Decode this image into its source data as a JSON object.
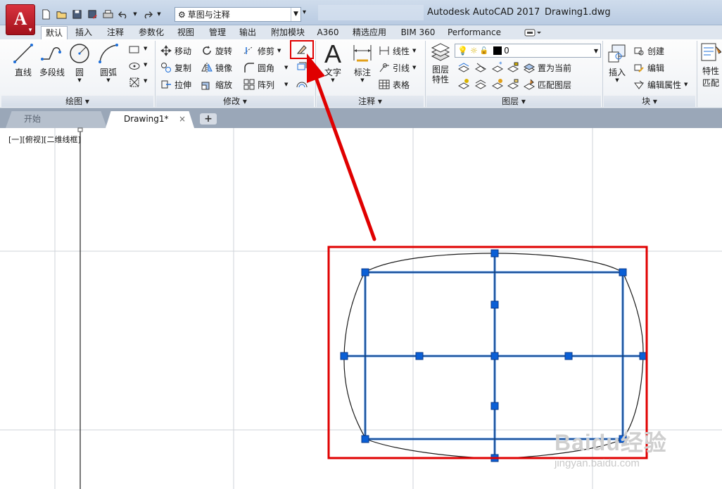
{
  "titlebar": {
    "app_logo": "A",
    "workspace": "草图与注释",
    "app_name": "Autodesk AutoCAD 2017",
    "document": "Drawing1.dwg",
    "qat_icons": [
      "new-icon",
      "open-icon",
      "save-icon",
      "save-as-icon",
      "plot-icon",
      "undo-icon",
      "redo-icon",
      "gear-icon"
    ]
  },
  "ribbon_tabs": [
    {
      "label": "默认",
      "active": true
    },
    {
      "label": "插入"
    },
    {
      "label": "注释"
    },
    {
      "label": "参数化"
    },
    {
      "label": "视图"
    },
    {
      "label": "管理"
    },
    {
      "label": "输出"
    },
    {
      "label": "附加模块"
    },
    {
      "label": "A360"
    },
    {
      "label": "精选应用"
    },
    {
      "label": "BIM 360"
    },
    {
      "label": "Performance"
    }
  ],
  "draw_panel": {
    "title": "绘图",
    "line": "直线",
    "polyline": "多段线",
    "circle": "圆",
    "arc": "圆弧"
  },
  "modify_panel": {
    "title": "修改",
    "move": "移动",
    "rotate": "旋转",
    "trim": "修剪",
    "copy": "复制",
    "mirror": "镜像",
    "fillet": "圆角",
    "stretch": "拉伸",
    "scale": "缩放",
    "array": "阵列",
    "highlighted_tool": "eraser-icon"
  },
  "annotation_panel": {
    "title": "注释",
    "text": "文字",
    "dimension": "标注",
    "linear": "线性",
    "leader": "引线",
    "table": "表格"
  },
  "layers_panel": {
    "title": "图层",
    "layer_properties": "图层\n特性",
    "current_layer": "0",
    "make_current": "置为当前",
    "match_layer": "匹配图层"
  },
  "block_panel": {
    "title": "块",
    "insert": "插入",
    "create": "创建",
    "edit": "编辑",
    "edit_attributes": "编辑属性"
  },
  "properties_panel": {
    "properties": "特性",
    "match": "匹配"
  },
  "file_tabs": {
    "start": "开始",
    "current": "Drawing1*",
    "close_glyph": "×",
    "add_glyph": "+"
  },
  "viewport": {
    "label": "[一][俯视][二维线框]"
  },
  "colors": {
    "selection_blue": "#1e6fd9",
    "grip_blue": "#0a5fd6",
    "annotation_red": "#e00000",
    "app_red": "#c01824"
  },
  "watermark": {
    "logo": "Baidu经验",
    "url": "jingyan.baidu.com"
  }
}
